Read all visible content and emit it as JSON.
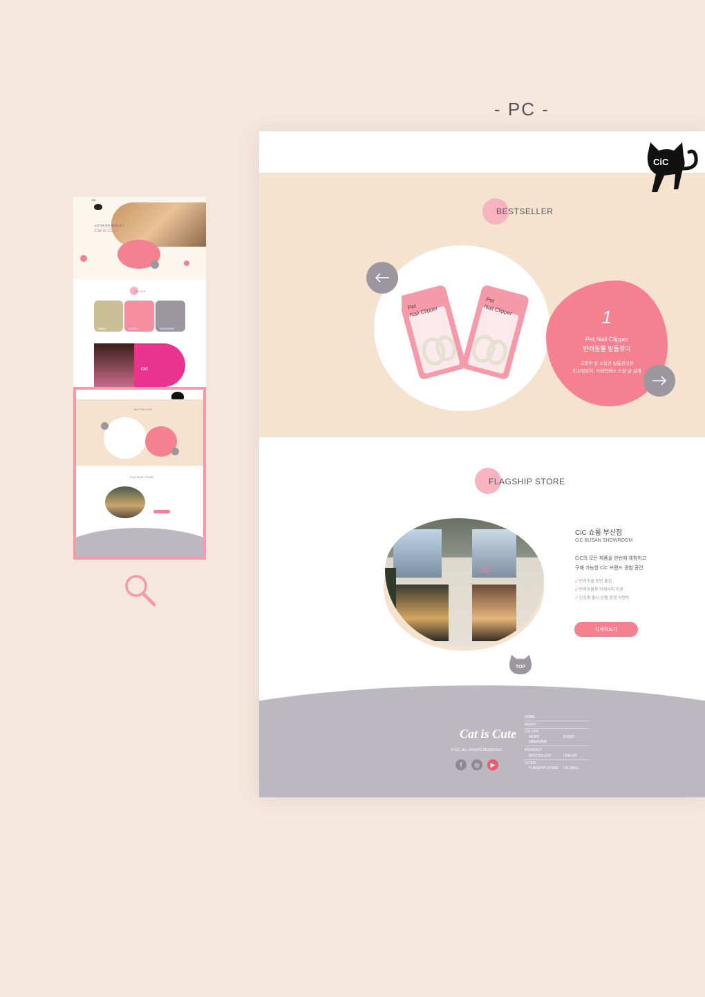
{
  "heading": "- PC -",
  "thumbnail": {
    "hero_line": "고양이에 관한 설레임 문구",
    "hero_tagline": "Cat is Cute!",
    "cic_life_label": "CIC LIFE",
    "cards": [
      "NEWS",
      "EVENT",
      "MAGAZINE"
    ],
    "promo_logo": "CiC",
    "best_label": "BESTSELLER",
    "flagship_label": "FLAGSHIP STORE"
  },
  "mock": {
    "bestseller": {
      "title": "BESTSELLER",
      "rank": "1",
      "product_en": "Pet Nail Clipper",
      "product_ko": "반려동물 발톱깎이",
      "desc_line1": "고양이 및 소형견 발톱관리용",
      "desc_line2": "미끄럼방지, 스테인레스 스틸 날 설계",
      "package_text": "Pet Nail Clipper",
      "package_sub": "반려동물 발톱깎이",
      "brand": "CiC"
    },
    "flagship": {
      "title": "FLAGSHIP STORE",
      "store_name": "CiC 쇼룸 부산점",
      "store_en": "CiC BUSAN SHOWROOM",
      "desc_line1": "CiC의 모든 제품을 한번에 체험하고",
      "desc_line2": "구매 가능한 CiC 브랜드 경험 공간",
      "features": [
        "반려동물 동반 출입",
        "반려동물용 악세서리 이용",
        "신상품 출시 상품 증정 이벤트"
      ],
      "button": "자세히보기",
      "sign": "CiC"
    },
    "top_button": "TOP",
    "footer": {
      "logo": "Cat is Cute",
      "copyright": "© CIC. ALL RIGHTS RESERVED.",
      "links": {
        "home": "HOME",
        "about": "ABOUT",
        "cic_life": "CIC LIFE",
        "news": "NEWS",
        "event": "EVENT",
        "magazine": "MAGAZINE",
        "product": "PRODUCT",
        "bestseller": "BESTSELLER",
        "lineup": "LINE-UP",
        "store": "STORE",
        "flagship": "FLAGSHIP STORE",
        "cic_mall": "CIC MALL"
      }
    },
    "logo_cat": "CiC"
  },
  "colors": {
    "background": "#f5e7dd",
    "beige": "#f5e3cf",
    "pink": "#f5808f",
    "light_pink": "#f7b3bf",
    "gray": "#bbb9bf",
    "button_gray": "#9c979e"
  }
}
